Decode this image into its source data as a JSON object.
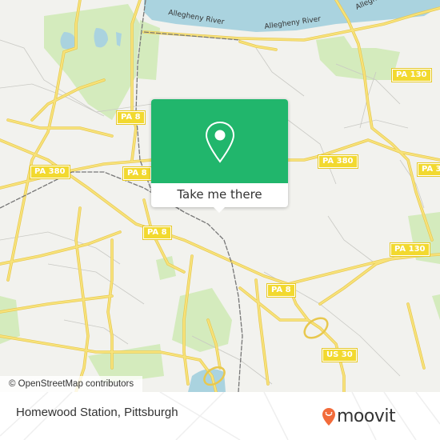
{
  "map": {
    "river_labels": [
      "Allegheny River",
      "Allegheny River",
      "Allegheny River"
    ],
    "shields": [
      "PA 8",
      "PA 130",
      "PA 380",
      "PA 8",
      "PA 380",
      "PA 3",
      "PA 8",
      "PA 130",
      "PA 8",
      "US 30"
    ],
    "attribution": "© OpenStreetMap contributors",
    "colors": {
      "background": "#f2f2ee",
      "water": "#aad3df",
      "park": "#c8e6a8",
      "road": "#f5dd6b",
      "road_casing": "#e8c84e",
      "rail": "#777777"
    }
  },
  "popup": {
    "icon": "map-pin-icon",
    "button_label": "Take me there",
    "accent": "#21b66c"
  },
  "footer": {
    "location_title": "Homewood Station, Pittsburgh",
    "brand": "moovit",
    "brand_color": "#f26b3a"
  }
}
